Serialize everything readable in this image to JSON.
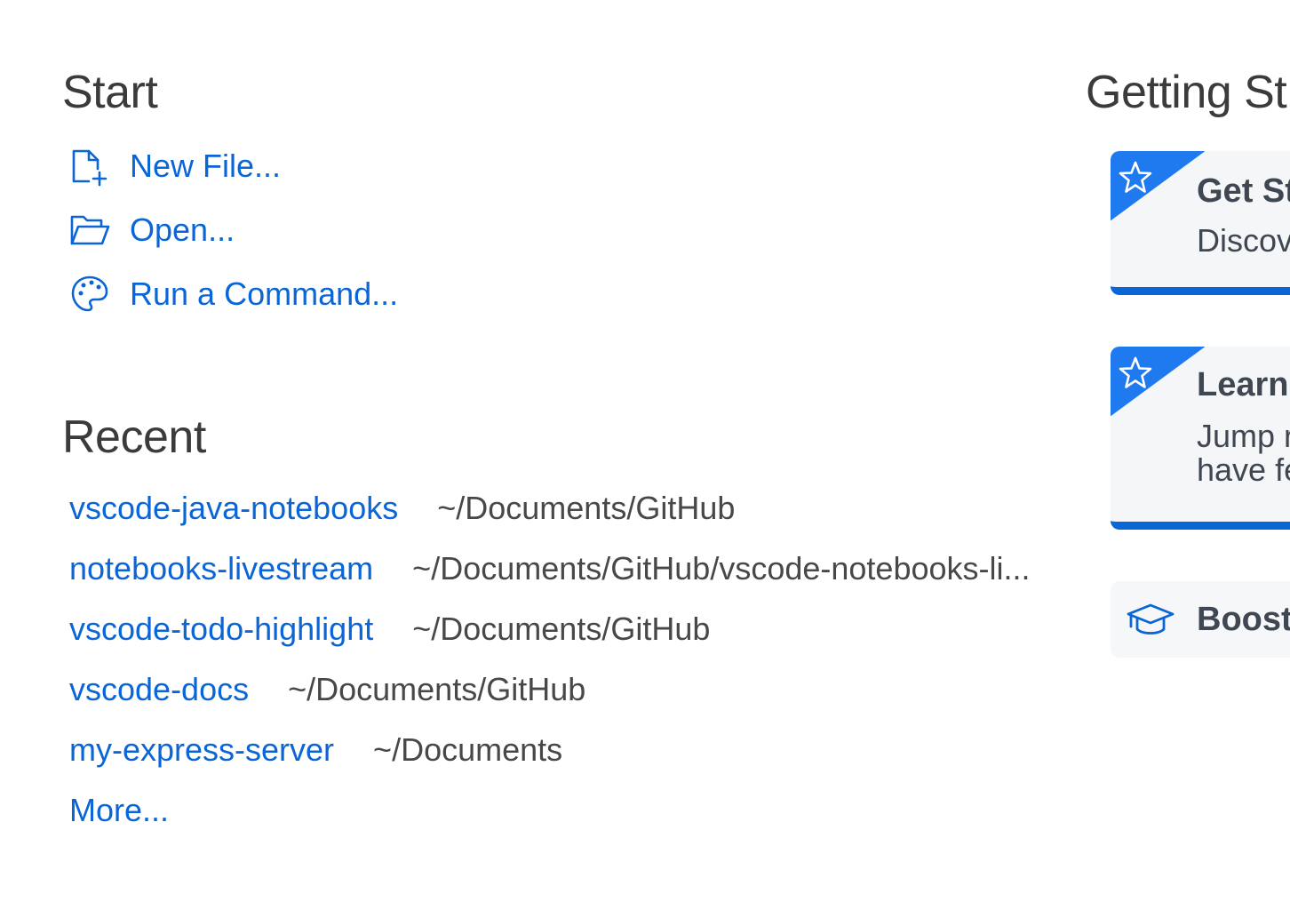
{
  "start": {
    "heading": "Start",
    "items": [
      {
        "label": "New File...",
        "icon": "new-file-icon"
      },
      {
        "label": "Open...",
        "icon": "folder-open-icon"
      },
      {
        "label": "Run a Command...",
        "icon": "palette-icon"
      }
    ]
  },
  "recent": {
    "heading": "Recent",
    "items": [
      {
        "name": "vscode-java-notebooks",
        "path": "~/Documents/GitHub"
      },
      {
        "name": "notebooks-livestream",
        "path": "~/Documents/GitHub/vscode-notebooks-li..."
      },
      {
        "name": "vscode-todo-highlight",
        "path": "~/Documents/GitHub"
      },
      {
        "name": "vscode-docs",
        "path": "~/Documents/GitHub"
      },
      {
        "name": "my-express-server",
        "path": "~/Documents"
      }
    ],
    "more": "More..."
  },
  "getting_started": {
    "heading": "Getting St",
    "cards": [
      {
        "title": "Get St",
        "description": "Discov",
        "icon": "star-icon"
      },
      {
        "title": "Learn",
        "description": "Jump r\nhave fe",
        "icon": "star-icon"
      },
      {
        "title": "Boost",
        "description": "",
        "icon": "mortarboard-icon"
      }
    ]
  },
  "colors": {
    "link": "#0a66d6",
    "accent": "#1f7af0",
    "text": "#3b3b3b",
    "card_bg": "#f5f6f8"
  }
}
